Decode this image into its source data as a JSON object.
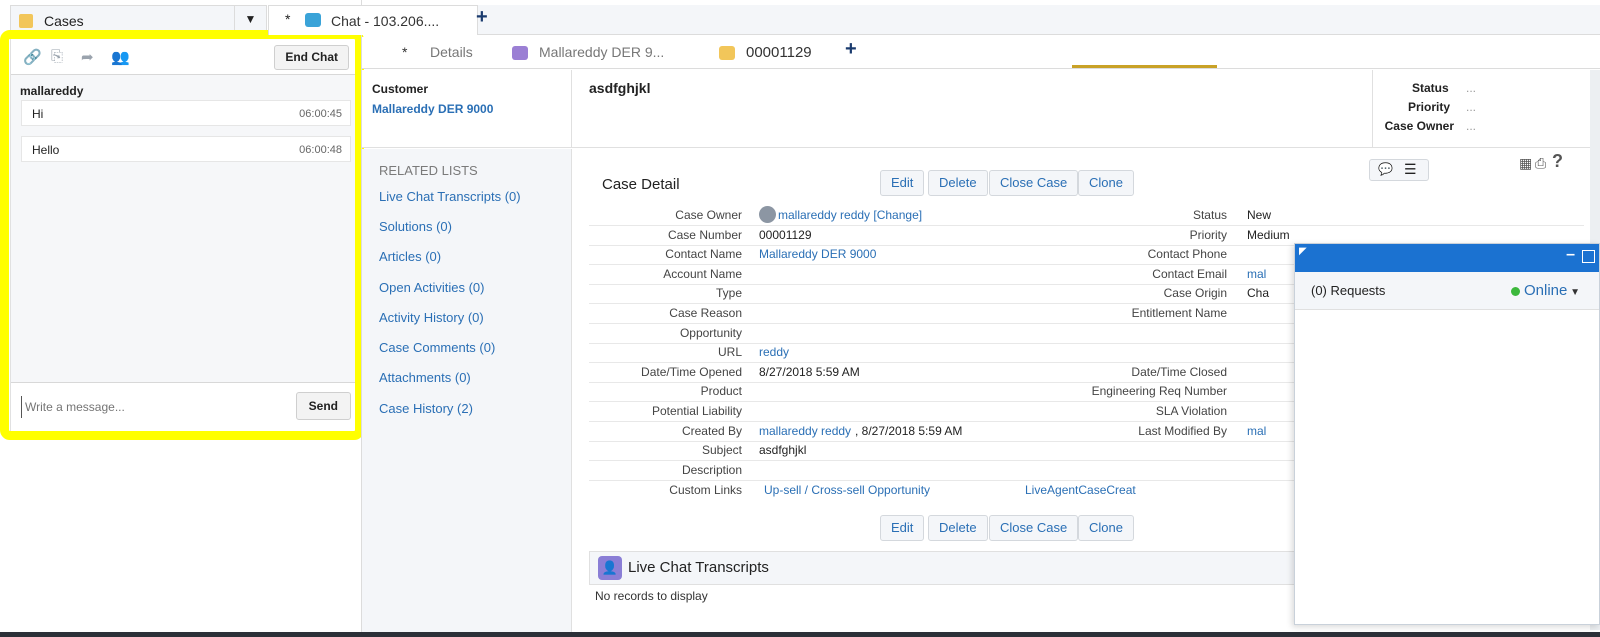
{
  "nav": {
    "app_label": "Cases"
  },
  "top_tabs": [
    {
      "label": "Chat - 103.206....",
      "modified": "*"
    }
  ],
  "sub_tabs": [
    {
      "label": "Details",
      "modified": "*"
    },
    {
      "label": "Mallareddy DER 9..."
    },
    {
      "label": "00001129"
    }
  ],
  "chat": {
    "end_chat_label": "End Chat",
    "visitor_name": "mallareddy",
    "messages": [
      {
        "text": "Hi",
        "time": "06:00:45"
      },
      {
        "text": "Hello",
        "time": "06:00:48"
      }
    ],
    "input_placeholder": "Write a message...",
    "send_label": "Send"
  },
  "header": {
    "customer_label": "Customer",
    "customer_value": "Mallareddy DER 9000",
    "subject": "asdfghjkl",
    "status_label": "Status",
    "priority_label": "Priority",
    "owner_label": "Case Owner",
    "status_value": "...",
    "priority_value": "...",
    "owner_value": "..."
  },
  "related": {
    "title": "RELATED LISTS",
    "items": [
      "Live Chat Transcripts (0)",
      "Solutions (0)",
      "Articles (0)",
      "Open Activities (0)",
      "Activity History (0)",
      "Case Comments (0)",
      "Attachments (0)",
      "Case History (2)"
    ]
  },
  "case_detail": {
    "title": "Case Detail",
    "buttons": [
      "Edit",
      "Delete",
      "Close Case",
      "Clone"
    ],
    "left_fields": [
      {
        "label": "Case Owner",
        "value": "mallareddy reddy [Change]"
      },
      {
        "label": "Case Number",
        "value": "00001129"
      },
      {
        "label": "Contact Name",
        "value": "Mallareddy DER 9000"
      },
      {
        "label": "Account Name",
        "value": ""
      },
      {
        "label": "Type",
        "value": ""
      },
      {
        "label": "Case Reason",
        "value": ""
      },
      {
        "label": "Opportunity",
        "value": ""
      },
      {
        "label": "URL",
        "value": "reddy"
      },
      {
        "label": "Date/Time Opened",
        "value": "8/27/2018 5:59 AM"
      },
      {
        "label": "Product",
        "value": ""
      },
      {
        "label": "Potential Liability",
        "value": ""
      },
      {
        "label": "Created By",
        "value": "mallareddy reddy",
        "extra": ", 8/27/2018 5:59 AM"
      },
      {
        "label": "Subject",
        "value": "asdfghjkl"
      },
      {
        "label": "Description",
        "value": ""
      }
    ],
    "right_fields": [
      {
        "label": "Status",
        "value": "New"
      },
      {
        "label": "Priority",
        "value": "Medium"
      },
      {
        "label": "Contact Phone",
        "value": ""
      },
      {
        "label": "Contact Email",
        "value": "mal"
      },
      {
        "label": "Case Origin",
        "value": "Cha"
      },
      {
        "label": "Entitlement Name",
        "value": ""
      },
      {
        "label": "",
        "value": ""
      },
      {
        "label": "",
        "value": ""
      },
      {
        "label": "Date/Time Closed",
        "value": ""
      },
      {
        "label": "Engineering Req Number",
        "value": ""
      },
      {
        "label": "SLA Violation",
        "value": ""
      },
      {
        "label": "Last Modified By",
        "value": "mal"
      }
    ],
    "custom_links_label": "Custom Links",
    "custom_links": [
      "Up-sell / Cross-sell Opportunity",
      "LiveAgentCaseCreat"
    ]
  },
  "live_chat_transcripts": {
    "title": "Live Chat Transcripts",
    "empty_text": "No records to display"
  },
  "omni": {
    "requests_label": "(0) Requests",
    "status_label": "Online"
  },
  "colors": {
    "highlight": "#ffff00",
    "link": "#2a6fb5",
    "omni_bar": "#1b72d1",
    "online": "#3cb83c"
  }
}
